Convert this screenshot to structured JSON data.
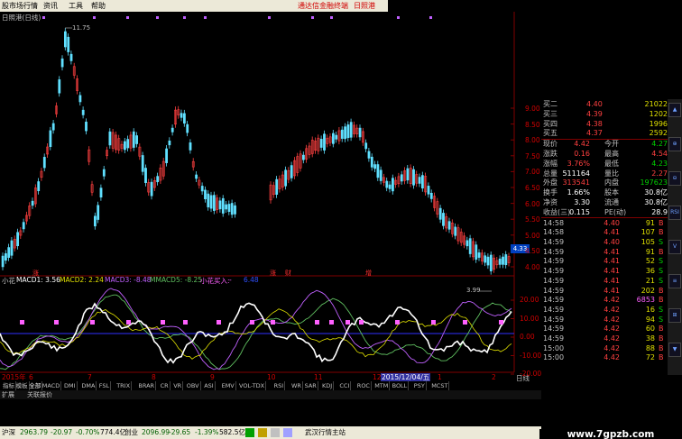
{
  "menu": {
    "items": [
      "股市场行情",
      "资讯",
      "工具",
      "帮助"
    ],
    "promo": "通达信金融终端",
    "stock_name": "日照港"
  },
  "chart": {
    "title": "日照港(日线)",
    "high_label": "11.75",
    "low_label": "3.99",
    "price_box": "4.33",
    "price_axis": [
      "9.00",
      "8.50",
      "8.00",
      "7.50",
      "7.00",
      "6.50",
      "6.00",
      "5.50",
      "5.00",
      "4.50",
      "4.00"
    ],
    "markers": [
      "涨",
      "财",
      "增"
    ]
  },
  "macd": {
    "legend": {
      "name": "小花",
      "macd1": "MACD1: 3.56",
      "macd2": "MACD2: 2.24",
      "macd3": "MACD3: -8.48",
      "macd5": "MMACD5: -8.25",
      "buy": "小花买入:",
      "buy_val": "-",
      "extra": "6.48"
    },
    "axis": [
      "20.00",
      "10.00",
      "0.00",
      "-10.00",
      "-20.00"
    ]
  },
  "date_axis": {
    "labels": [
      "2015年",
      "6",
      "7",
      "8",
      "9",
      "10",
      "11",
      "12",
      "2015/12/04/五",
      "1",
      "2"
    ],
    "period": "日线"
  },
  "tabs": [
    "指标",
    "模板",
    "全部",
    "MACD",
    "DMI",
    "DMA",
    "FSL",
    "TRIX",
    "BRAR",
    "CR",
    "VR",
    "OBV",
    "ASI",
    "EMV",
    "VOL-TDX",
    "RSI",
    "WR",
    "SAR",
    "KDJ",
    "CCI",
    "ROC",
    "MTM",
    "BOLL",
    "PSY",
    "MCST"
  ],
  "subtabs": [
    "扩展",
    "关联报价"
  ],
  "quote": {
    "bids": [
      {
        "label": "买二",
        "price": "4.40",
        "vol": "21022"
      },
      {
        "label": "买三",
        "price": "4.39",
        "vol": "1202"
      },
      {
        "label": "买四",
        "price": "4.38",
        "vol": "1996"
      },
      {
        "label": "买五",
        "price": "4.37",
        "vol": "2592"
      }
    ],
    "stats": [
      {
        "l1": "现价",
        "v1": "4.42",
        "c1": "red",
        "l2": "今开",
        "v2": "4.27",
        "c2": "grn"
      },
      {
        "l1": "涨跌",
        "v1": "0.16",
        "c1": "red",
        "l2": "最高",
        "v2": "4.54",
        "c2": "red"
      },
      {
        "l1": "涨幅",
        "v1": "3.76%",
        "c1": "red",
        "l2": "最低",
        "v2": "4.23",
        "c2": "grn"
      },
      {
        "l1": "总量",
        "v1": "511164",
        "c1": "wht",
        "l2": "量比",
        "v2": "2.27",
        "c2": "red"
      },
      {
        "l1": "外盘",
        "v1": "313541",
        "c1": "red",
        "l2": "内盘",
        "v2": "197623",
        "c2": "grn"
      },
      {
        "l1": "换手",
        "v1": "1.66%",
        "c1": "wht",
        "l2": "股本",
        "v2": "30.8亿",
        "c2": "wht"
      },
      {
        "l1": "净资",
        "v1": "3.30",
        "c1": "wht",
        "l2": "流通",
        "v2": "30.8亿",
        "c2": "wht"
      },
      {
        "l1": "收益(三)",
        "v1": "0.115",
        "c1": "wht",
        "l2": "PE(动)",
        "v2": "28.9",
        "c2": "wht"
      }
    ],
    "ticks": [
      {
        "time": "14:58",
        "price": "4.40",
        "vol": "91",
        "flag": "B"
      },
      {
        "time": "14:58",
        "price": "4.41",
        "vol": "107",
        "flag": "B"
      },
      {
        "time": "14:59",
        "price": "4.40",
        "vol": "105",
        "flag": "S"
      },
      {
        "time": "14:59",
        "price": "4.41",
        "vol": "91",
        "flag": "B"
      },
      {
        "time": "14:59",
        "price": "4.41",
        "vol": "52",
        "flag": "S"
      },
      {
        "time": "14:59",
        "price": "4.41",
        "vol": "36",
        "flag": "S"
      },
      {
        "time": "14:59",
        "price": "4.41",
        "vol": "21",
        "flag": "S"
      },
      {
        "time": "14:59",
        "price": "4.41",
        "vol": "202",
        "flag": "B"
      },
      {
        "time": "14:59",
        "price": "4.42",
        "vol": "6853",
        "flag": "B"
      },
      {
        "time": "14:59",
        "price": "4.42",
        "vol": "16",
        "flag": "S"
      },
      {
        "time": "14:59",
        "price": "4.42",
        "vol": "94",
        "flag": "S"
      },
      {
        "time": "14:59",
        "price": "4.42",
        "vol": "60",
        "flag": "B"
      },
      {
        "time": "14:59",
        "price": "4.42",
        "vol": "38",
        "flag": "B"
      },
      {
        "time": "15:00",
        "price": "4.42",
        "vol": "88",
        "flag": "B"
      },
      {
        "time": "15:00",
        "price": "4.42",
        "vol": "72",
        "flag": "B"
      }
    ]
  },
  "rightbar": [
    "▲",
    "⊕",
    "⊖",
    "RSI",
    "V",
    "≡",
    "⊞",
    "▼"
  ],
  "status": {
    "sh_label": "沪深",
    "sh_val": "2963.79",
    "sh_chg": "-20.97",
    "sh_pct": "-0.70%",
    "sh_amt": "774.4亿",
    "cy_label": "创业",
    "cy_val": "2096.99",
    "cy_chg": "-29.65",
    "cy_pct": "-1.39%",
    "cy_amt": "582.5亿",
    "site": "武汉行情主站"
  },
  "watermark": "www.7gpzb.com",
  "colors": {
    "up": "#ff4040",
    "down": "#00e0e0",
    "macd_white": "#ffffff",
    "macd_purple": "#c060ff",
    "macd_green": "#60c060"
  }
}
